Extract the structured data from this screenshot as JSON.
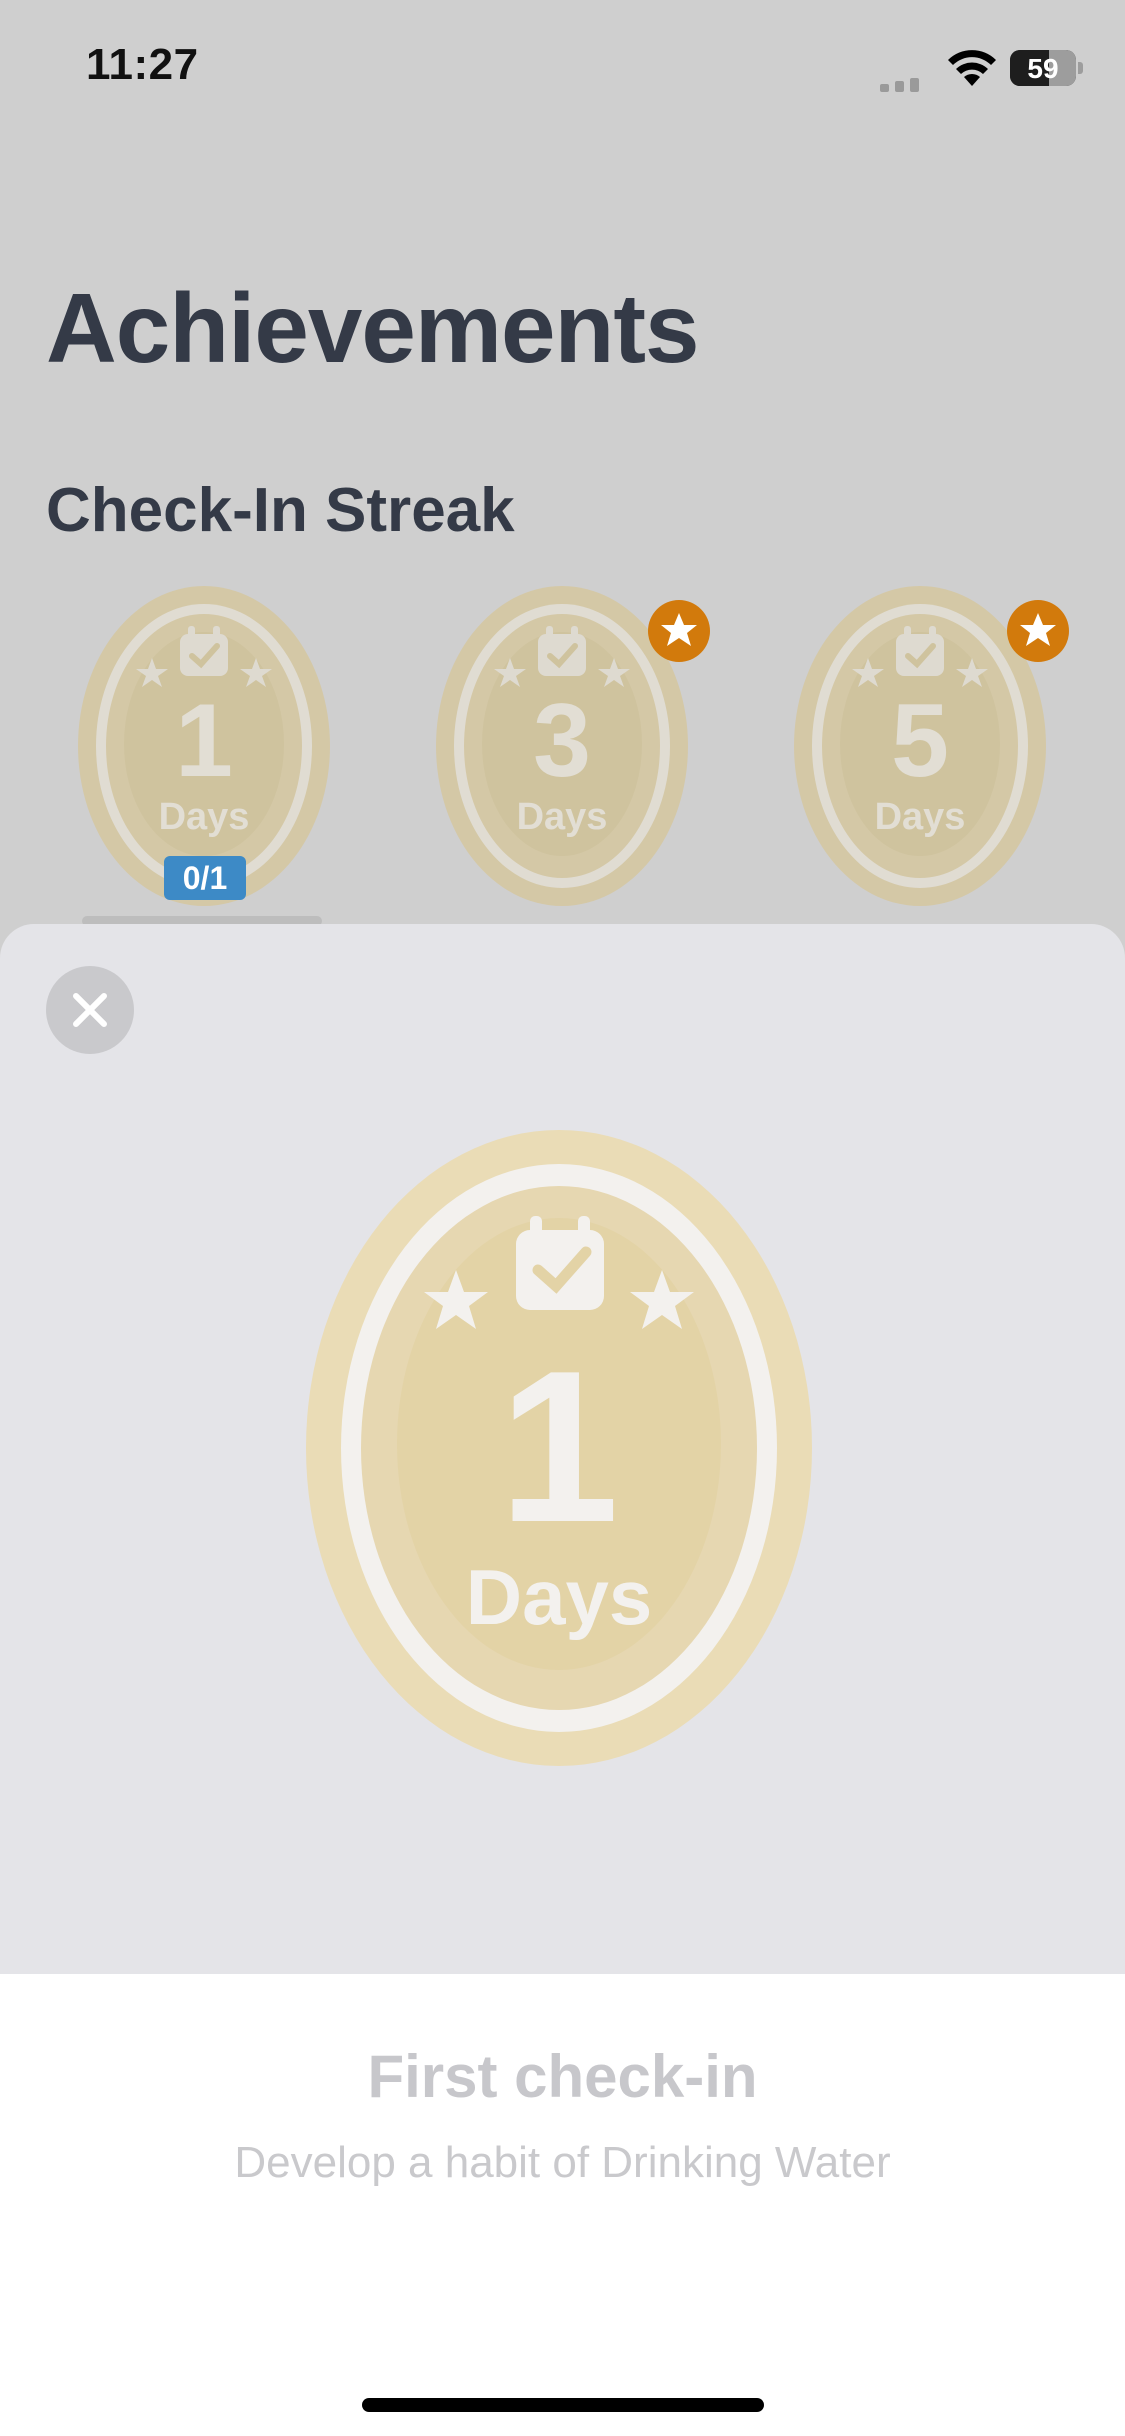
{
  "status_bar": {
    "time": "11:27",
    "battery": "59"
  },
  "page": {
    "title": "Achievements"
  },
  "sections": [
    {
      "title": "Check-In Streak",
      "badges": [
        {
          "number": "1",
          "unit": "Days",
          "progress": "0/1",
          "starred": false
        },
        {
          "number": "3",
          "unit": "Days",
          "starred": true
        },
        {
          "number": "5",
          "unit": "Days",
          "starred": true
        }
      ]
    }
  ],
  "detail_sheet": {
    "badge_number": "1",
    "badge_unit": "Days",
    "title": "First check-in",
    "subtitle": "Develop a habit of Drinking Water"
  },
  "icons": [
    "signal-icon",
    "wifi-icon",
    "battery-icon",
    "calendar-check-icon",
    "star-icon",
    "close-icon"
  ],
  "colors": {
    "accent_orange": "#d27a0c",
    "progress_blue": "#3d8ac6",
    "badge_gold": "#e3d3a6"
  }
}
